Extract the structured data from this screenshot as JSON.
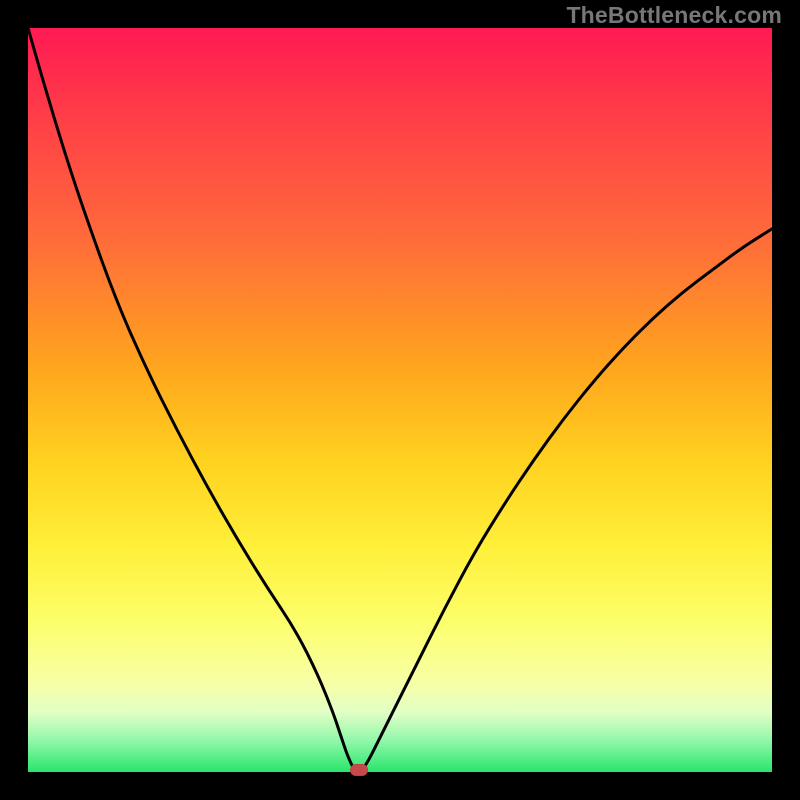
{
  "watermark": "TheBottleneck.com",
  "colors": {
    "frame": "#000000",
    "curve": "#000000",
    "marker": "#c74a4a",
    "gradient_stops": [
      "#ff1a53",
      "#ff3e47",
      "#ff6a3b",
      "#ffa31e",
      "#ffd11f",
      "#fff03a",
      "#fcff6c",
      "#f7ffa6",
      "#e1ffc5",
      "#8cf7a7",
      "#28e56a"
    ]
  },
  "chart_data": {
    "type": "line",
    "title": "",
    "xlabel": "",
    "ylabel": "",
    "xlim": [
      0,
      100
    ],
    "ylim": [
      0,
      100
    ],
    "x": [
      0,
      2,
      5,
      8,
      12,
      16,
      20,
      24,
      28,
      32,
      36,
      39,
      41,
      42,
      43,
      44,
      45,
      48,
      52,
      56,
      60,
      64,
      68,
      72,
      76,
      80,
      84,
      88,
      92,
      96,
      100
    ],
    "y": [
      100,
      93,
      83,
      74,
      63,
      54,
      46,
      38.5,
      31.5,
      25,
      19,
      13,
      8,
      5,
      2,
      0,
      0,
      6,
      14,
      22,
      29.5,
      36,
      42,
      47.5,
      52.5,
      57,
      61,
      64.5,
      67.5,
      70.5,
      73
    ],
    "minimum_marker": {
      "x": 44.5,
      "y": 0
    },
    "annotations": []
  }
}
